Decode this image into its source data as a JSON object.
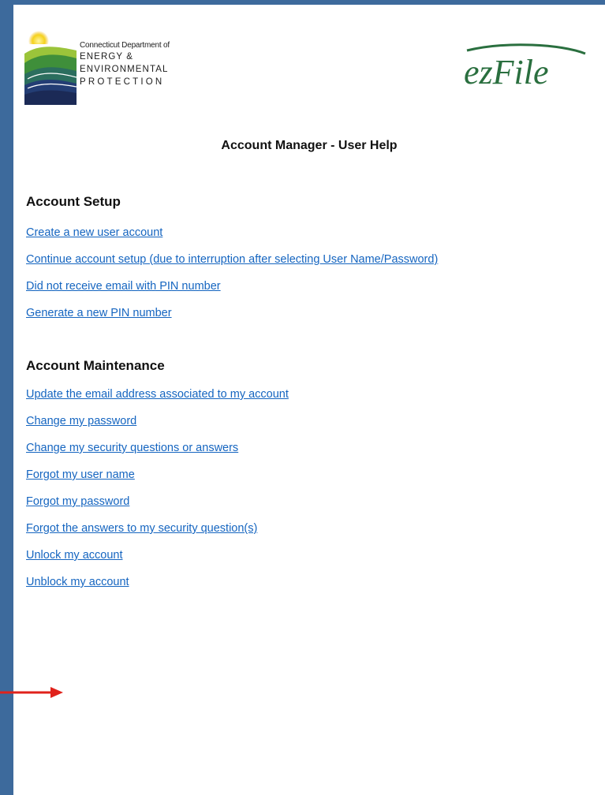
{
  "header": {
    "deep_logo": {
      "line1": "Connecticut Department of",
      "line2": "ENERGY &",
      "line3": "ENVIRONMENTAL",
      "line4": "PROTECTION"
    },
    "ezfile_logo": {
      "text": "ezFile"
    }
  },
  "title": "Account Manager - User Help",
  "sections": {
    "setup": {
      "heading": "Account Setup",
      "links": [
        "Create a new user account",
        "Continue account setup (due to interruption after selecting User Name/Password)",
        "Did not receive email with PIN number",
        "Generate a new PIN number"
      ]
    },
    "maintenance": {
      "heading": "Account Maintenance",
      "links": [
        "Update the email address associated to my account",
        "Change my password",
        "Change my security questions or answers",
        "Forgot my user name",
        "Forgot my password",
        "Forgot the answers to my security question(s)",
        "Unlock my account",
        "Unblock my account"
      ]
    }
  },
  "colors": {
    "frame": "#3d6a9c",
    "link": "#1565c0",
    "annotation_arrow": "#e0221b"
  },
  "icons": {
    "deep_logo": "deep-landscape-logo",
    "ezfile_logo": "ezfile-logo",
    "annotation": "red-arrow-icon"
  }
}
